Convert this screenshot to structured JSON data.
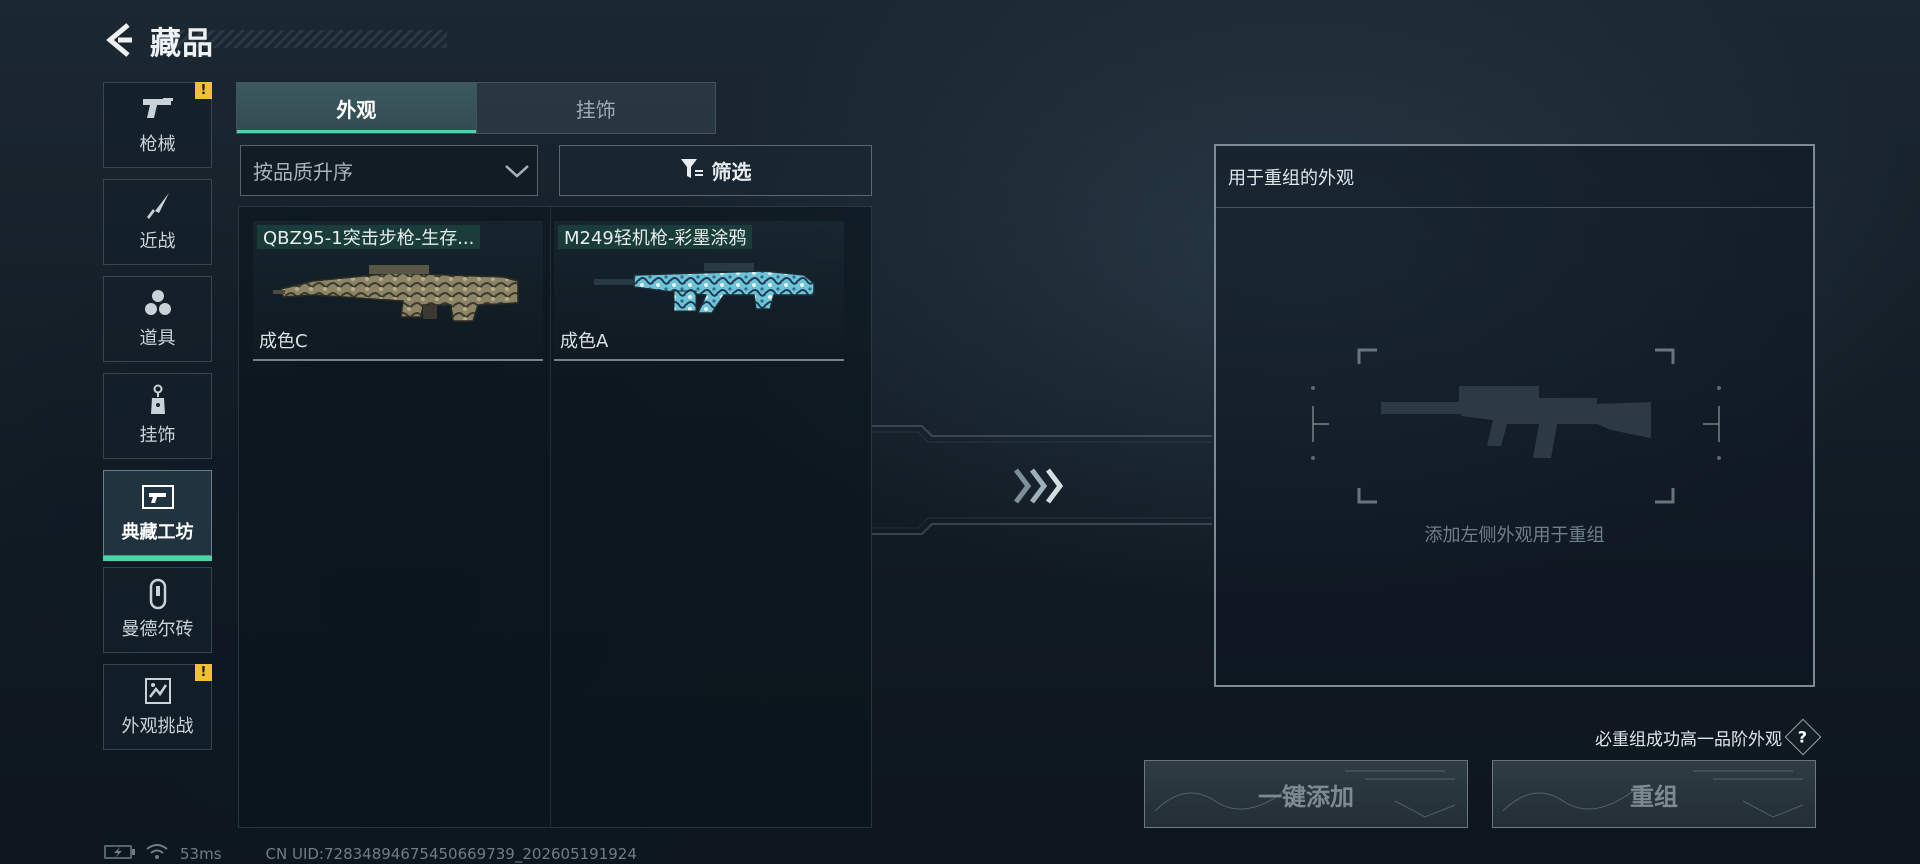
{
  "header": {
    "title": "藏品"
  },
  "sidebar": {
    "items": [
      {
        "label": "枪械",
        "icon": "pistol-icon",
        "badge": "!"
      },
      {
        "label": "近战",
        "icon": "knife-icon",
        "badge": ""
      },
      {
        "label": "道具",
        "icon": "grenades-icon",
        "badge": ""
      },
      {
        "label": "挂饰",
        "icon": "charm-icon",
        "badge": ""
      },
      {
        "label": "典藏工坊",
        "icon": "workshop-icon",
        "badge": "",
        "active": true
      },
      {
        "label": "曼德尔砖",
        "icon": "mandel-brick-icon",
        "badge": ""
      },
      {
        "label": "外观挑战",
        "icon": "challenge-icon",
        "badge": "!"
      }
    ]
  },
  "tabs": [
    {
      "label": "外观",
      "active": true
    },
    {
      "label": "挂饰",
      "active": false
    }
  ],
  "sort": {
    "value": "按品质升序"
  },
  "filter": {
    "label": "筛选"
  },
  "cards": [
    {
      "title": "QBZ95-1突击步枪-生存...",
      "grade": "成色C",
      "gun_icon": "qbz95-rifle-image"
    },
    {
      "title": "M249轻机枪-彩墨涂鸦",
      "grade": "成色A",
      "gun_icon": "m249-lmg-image"
    }
  ],
  "recombine": {
    "title": "用于重组的外观",
    "empty_hint": "添加左侧外观用于重组"
  },
  "upgrade_note": "必重组成功高一品阶外观",
  "help_label": "?",
  "buttons": {
    "add_all": "一键添加",
    "recombine": "重组"
  },
  "status": {
    "ping": "53ms",
    "uid": "CN UID:72834894675450669739_202605191924"
  },
  "colors": {
    "accent": "#4fd3a6",
    "warning": "#f0c233",
    "background": "#121c25"
  }
}
